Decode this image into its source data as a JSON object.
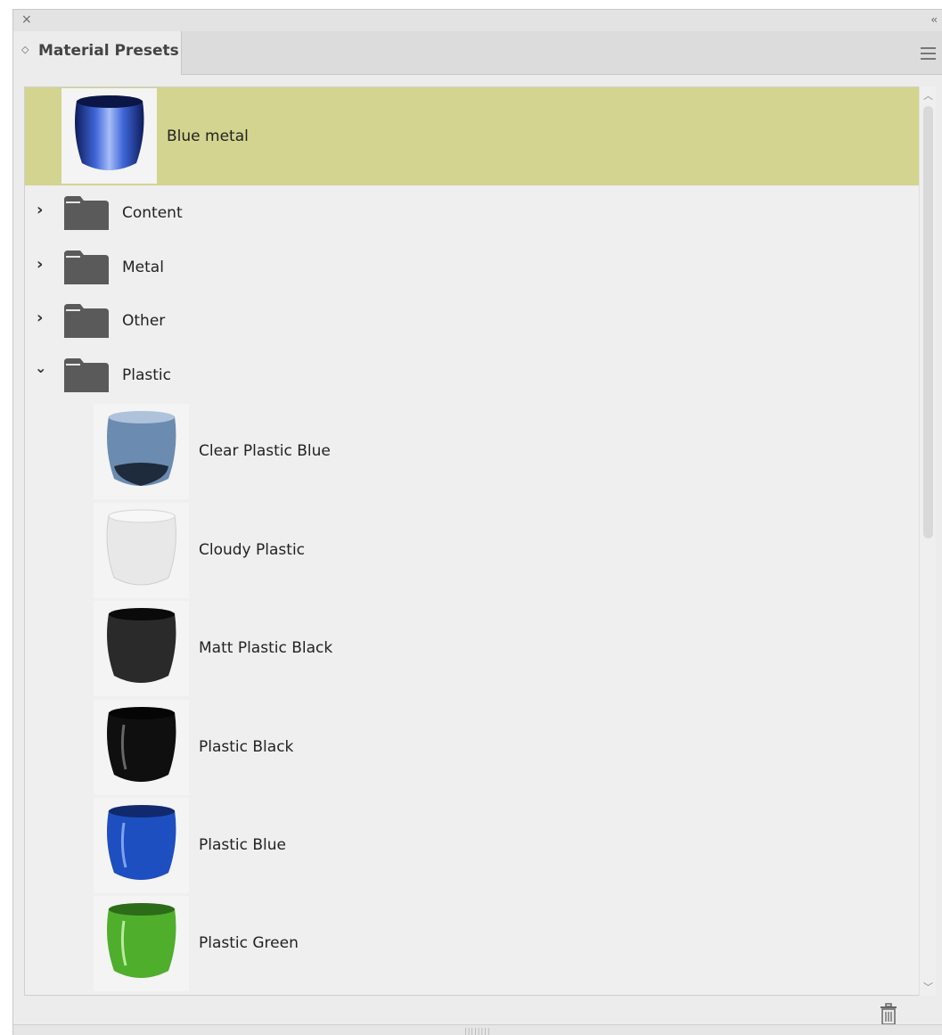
{
  "panel": {
    "title": "Material Presets",
    "close_glyph": "×",
    "collapse_glyph": "‹‹",
    "tab_icon_glyph": "◇",
    "grip_glyph": "||||||||"
  },
  "list": {
    "selected": {
      "label": "Blue metal",
      "thumb_color": "#2a4db8"
    },
    "folders": [
      {
        "label": "Content",
        "expanded": false
      },
      {
        "label": "Metal",
        "expanded": false
      },
      {
        "label": "Other",
        "expanded": false
      },
      {
        "label": "Plastic",
        "expanded": true
      }
    ],
    "plastic_items": [
      {
        "label": "Clear Plastic Blue",
        "color": "#6c8bb0",
        "rim": "#1e2b3c"
      },
      {
        "label": "Cloudy Plastic",
        "color": "#e8e8e8",
        "rim": "#c8c8c8"
      },
      {
        "label": "Matt Plastic Black",
        "color": "#2a2a2a",
        "rim": "#111111"
      },
      {
        "label": "Plastic Black",
        "color": "#0f0f0f",
        "rim": "#050505"
      },
      {
        "label": "Plastic Blue",
        "color": "#1d4fc0",
        "rim": "#112a6d"
      },
      {
        "label": "Plastic Green",
        "color": "#4fae2c",
        "rim": "#2c6b18"
      }
    ]
  },
  "colors": {
    "selected_bg": "#d3d48f",
    "folder": "#5a5a5a"
  },
  "icons": {
    "close": "close-icon",
    "collapse": "collapse-icon",
    "menu": "hamburger-menu-icon",
    "folder": "folder-icon",
    "chevron_right": "chevron-right-icon",
    "chevron_down": "chevron-down-icon",
    "trash": "trash-icon"
  }
}
